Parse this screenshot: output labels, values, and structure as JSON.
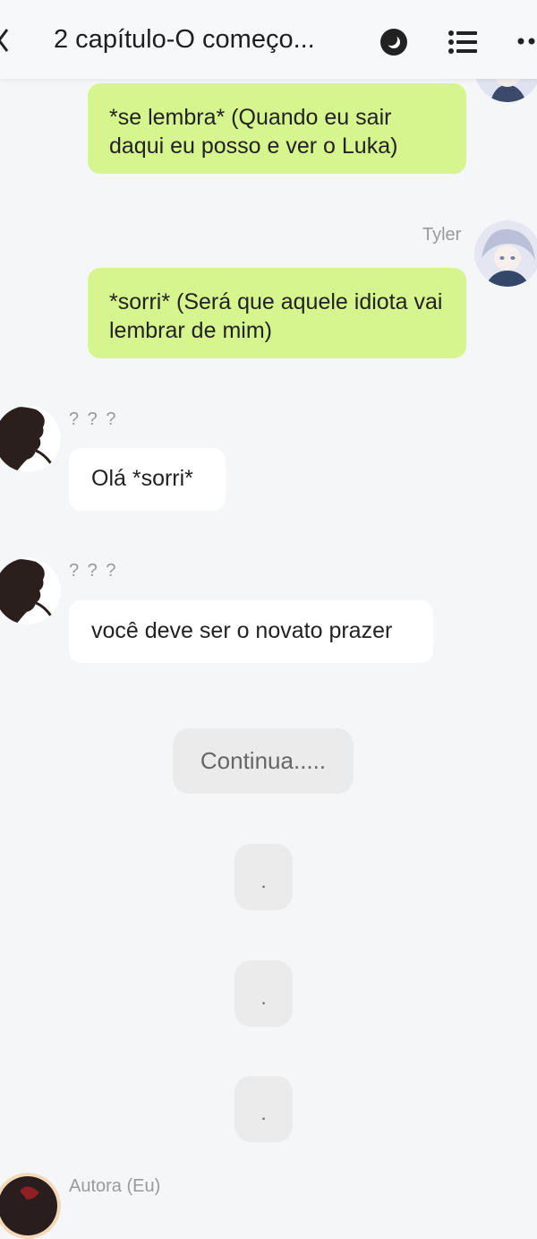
{
  "header": {
    "title": "2 capítulo-O começo...",
    "icons": [
      "chevron-left-icon",
      "night-mode-icon",
      "list-icon",
      "more-icon"
    ]
  },
  "messages": [
    {
      "side": "right",
      "text": "*se lembra* (Quando eu sair daqui eu posso e ver o Luka)",
      "color": "#d6f58f"
    },
    {
      "side": "right",
      "sender": "Tyler",
      "text": "*sorri* (Será que aquele idiota vai lembrar de mim)",
      "color": "#d6f58f"
    },
    {
      "side": "left",
      "sender": "? ? ?",
      "text": "Olá *sorri*",
      "color": "#ffffff"
    },
    {
      "side": "left",
      "sender": "? ? ?",
      "text": "você deve ser o novato prazer",
      "color": "#ffffff"
    }
  ],
  "system_messages": [
    "Continua.....",
    ".",
    ".",
    "."
  ],
  "last_sender": "Autora (Eu)",
  "colors": {
    "background": "#f5f6f8",
    "green_bubble": "#d6f58f",
    "white_bubble": "#ffffff",
    "system_bubble": "#ebebeb"
  }
}
